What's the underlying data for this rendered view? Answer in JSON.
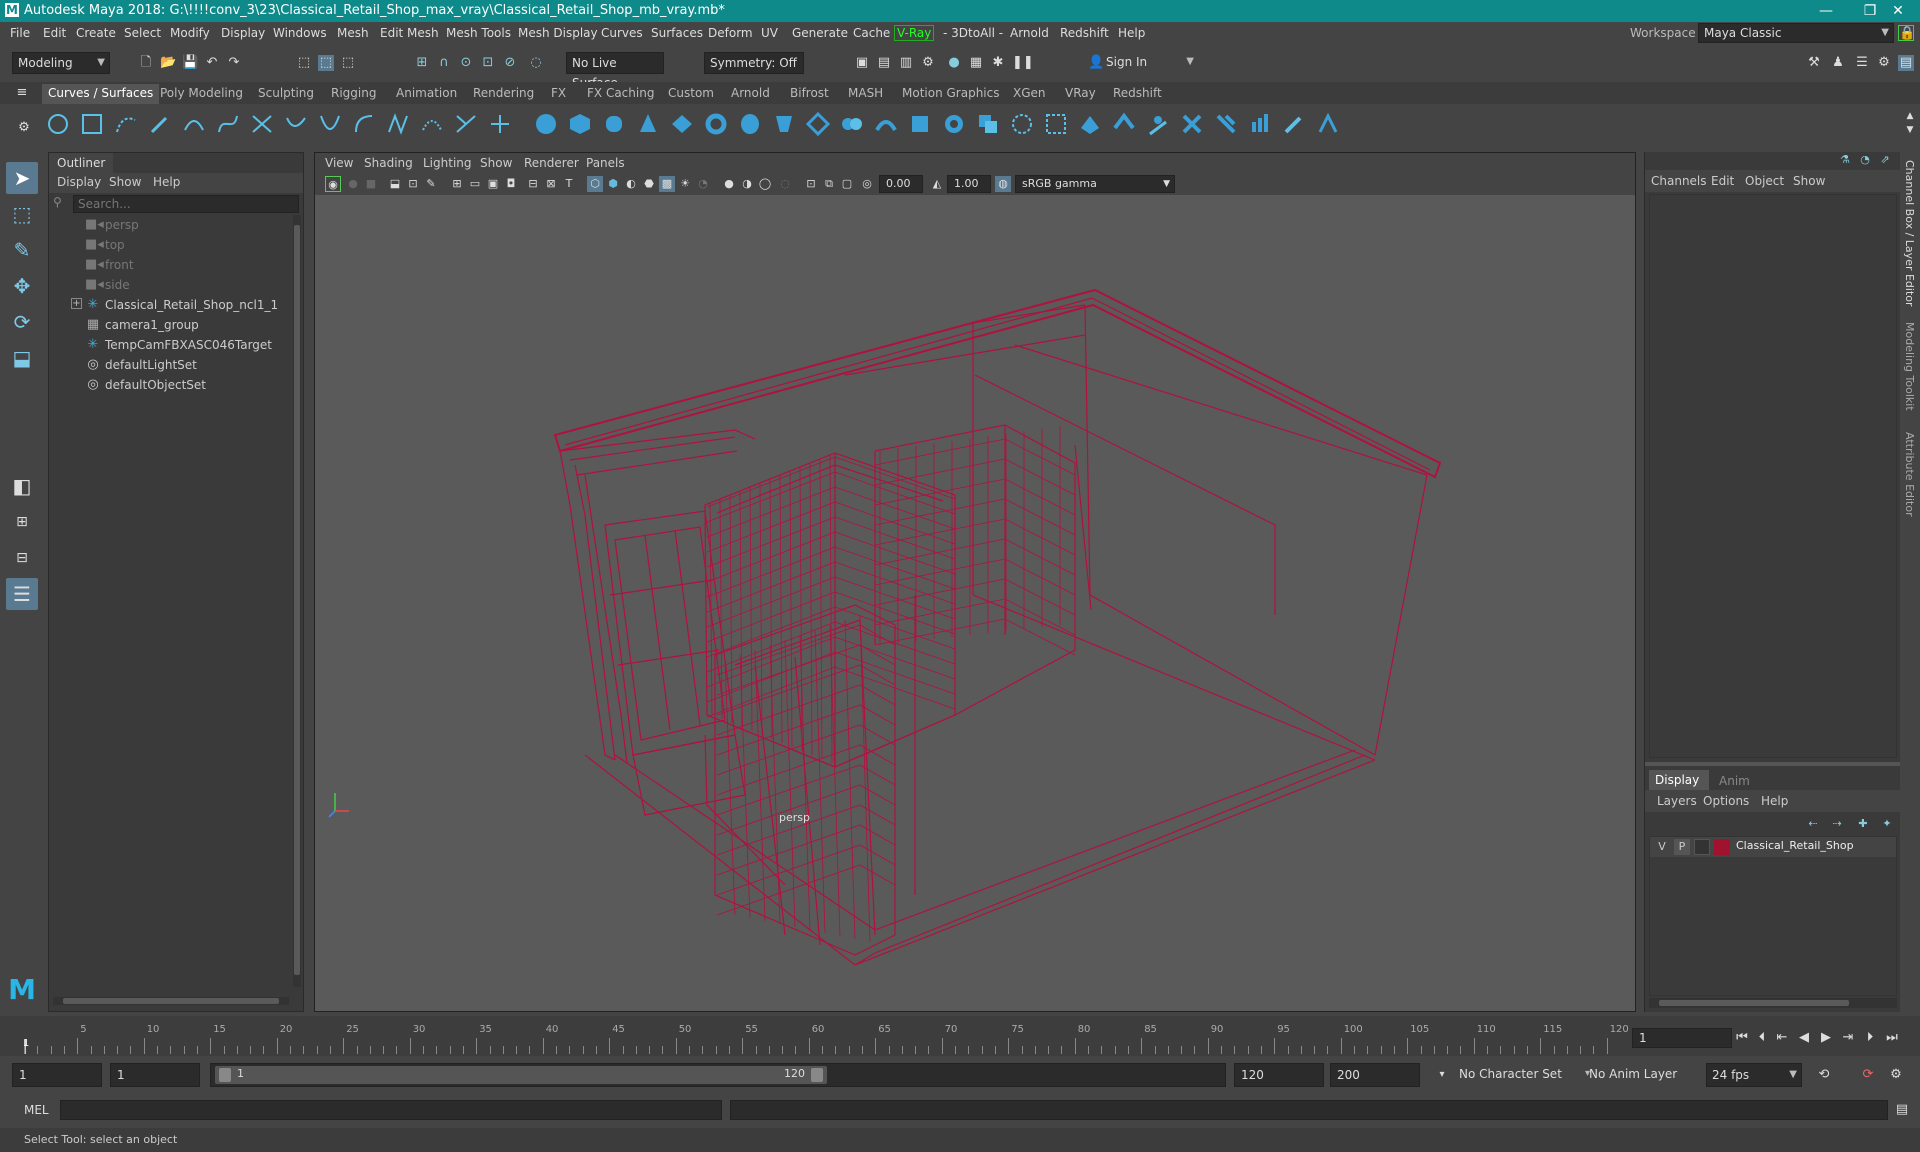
{
  "window": {
    "title": "Autodesk Maya 2018: G:\\!!!!conv_3\\23\\Classical_Retail_Shop_max_vray\\Classical_Retail_Shop_mb_vray.mb*",
    "logo": "M"
  },
  "menubar": {
    "items": [
      "File",
      "Edit",
      "Create",
      "Select",
      "Modify",
      "Display",
      "Windows",
      "Mesh",
      "Edit Mesh",
      "Mesh Tools",
      "Mesh Display",
      "Curves",
      "Surfaces",
      "Deform",
      "UV",
      "Generate",
      "Cache",
      "V-Ray",
      "- 3DtoAll -",
      "Arnold",
      "Redshift",
      "Help"
    ],
    "workspace_label": "Workspace :",
    "workspace_value": "Maya Classic"
  },
  "statusline": {
    "mode": "Modeling",
    "live_surface": "No Live Surface",
    "symmetry": "Symmetry: Off",
    "sign_in": "Sign In"
  },
  "shelf": {
    "tabs": [
      "Curves / Surfaces",
      "Poly Modeling",
      "Sculpting",
      "Rigging",
      "Animation",
      "Rendering",
      "FX",
      "FX Caching",
      "Custom",
      "Arnold",
      "Bifrost",
      "MASH",
      "Motion Graphics",
      "XGen",
      "VRay",
      "Redshift"
    ],
    "active_tab": 0
  },
  "outliner": {
    "title": "Outliner",
    "menu": [
      "Display",
      "Show",
      "Help"
    ],
    "search_placeholder": "Search...",
    "items": [
      {
        "label": "persp",
        "icon": "camera-icon",
        "dim": true
      },
      {
        "label": "top",
        "icon": "camera-icon",
        "dim": true
      },
      {
        "label": "front",
        "icon": "camera-icon",
        "dim": true
      },
      {
        "label": "side",
        "icon": "camera-icon",
        "dim": true
      },
      {
        "label": "Classical_Retail_Shop_ncl1_1",
        "icon": "transform-icon",
        "dim": false,
        "expandable": true
      },
      {
        "label": "camera1_group",
        "icon": "group-icon",
        "dim": false
      },
      {
        "label": "TempCamFBXASC046Target",
        "icon": "transform-icon",
        "dim": false
      },
      {
        "label": "defaultLightSet",
        "icon": "set-icon",
        "dim": false
      },
      {
        "label": "defaultObjectSet",
        "icon": "set-icon",
        "dim": false
      }
    ]
  },
  "viewport": {
    "menu": [
      "View",
      "Shading",
      "Lighting",
      "Show",
      "Renderer",
      "Panels"
    ],
    "exposure": "0.00",
    "gamma": "1.00",
    "color_space": "sRGB gamma",
    "camera_label": "persp",
    "wire_color": "#b0123f"
  },
  "channelbox": {
    "menu": [
      "Channels",
      "Edit",
      "Object",
      "Show"
    ],
    "layer_tabs": [
      "Display",
      "Anim"
    ],
    "layer_menu": [
      "Layers",
      "Options",
      "Help"
    ],
    "layer": {
      "v": "V",
      "p": "P",
      "name": "Classical_Retail_Shop",
      "color": "#a0122e"
    },
    "side_tabs": [
      "Channel Box / Layer Editor",
      "Modeling Toolkit",
      "Attribute Editor"
    ]
  },
  "timeline": {
    "ticks": [
      "5",
      "10",
      "15",
      "20",
      "25",
      "30",
      "35",
      "40",
      "45",
      "50",
      "55",
      "60",
      "65",
      "70",
      "75",
      "80",
      "85",
      "90",
      "95",
      "100",
      "105",
      "110",
      "115",
      "120"
    ],
    "first_tick": "1",
    "current_frame": "1"
  },
  "range": {
    "start": "1",
    "playback_start": "1",
    "slider_start": "1",
    "slider_end": "120",
    "playback_end": "120",
    "end": "200",
    "character_set": "No Character Set",
    "anim_layer": "No Anim Layer",
    "fps": "24 fps"
  },
  "cmdline": {
    "lang": "MEL"
  },
  "helpline": {
    "text": "Select Tool: select an object"
  }
}
